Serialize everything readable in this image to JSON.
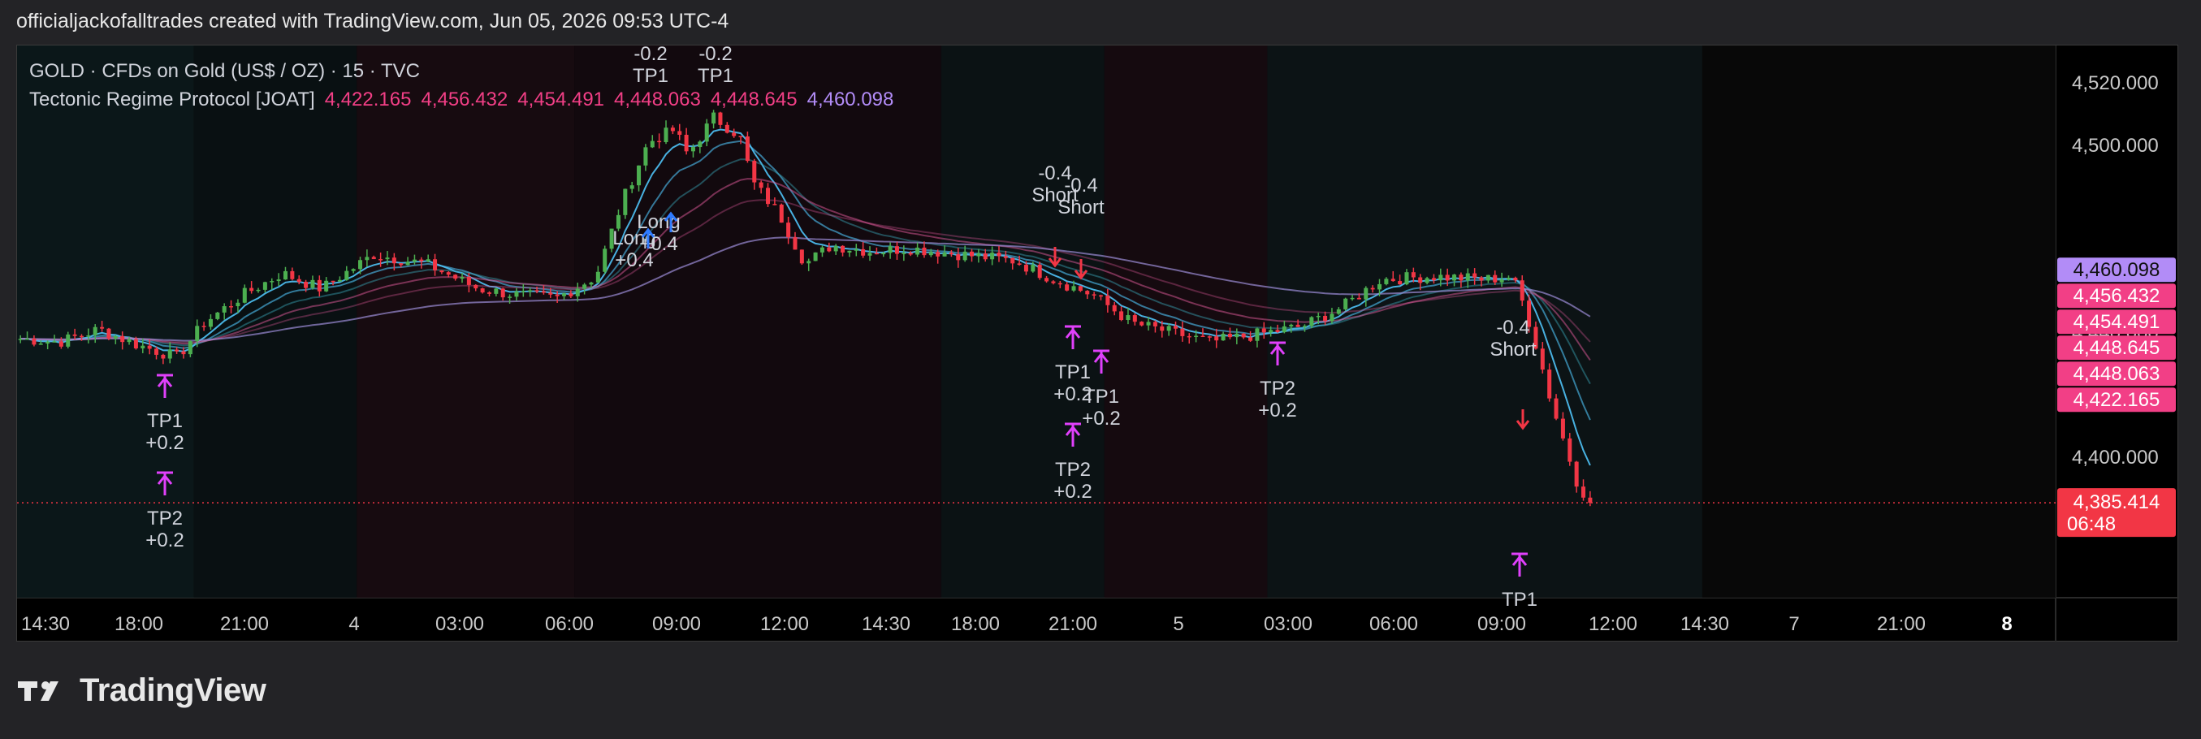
{
  "caption": "officialjackofalltrades created with TradingView.com, Jun 05, 2026 09:53 UTC-4",
  "legend": {
    "symbol_line": "GOLD · CFDs on Gold (US$ / OZ) · 15 · TVC",
    "indicator_name": "Tectonic Regime Protocol [JOAT]",
    "indicator_values": [
      {
        "text": "4,422.165",
        "color": "#f23f86"
      },
      {
        "text": "4,456.432",
        "color": "#f23f86"
      },
      {
        "text": "4,454.491",
        "color": "#f23f86"
      },
      {
        "text": "4,448.063",
        "color": "#f23f86"
      },
      {
        "text": "4,448.645",
        "color": "#f23f86"
      },
      {
        "text": "4,460.098",
        "color": "#b28cf7"
      }
    ]
  },
  "colors": {
    "up": "#4caf50",
    "down": "#f23645",
    "cyan": "#4fc3f7",
    "pink": "#e05a9a",
    "purple": "#9b8cd6",
    "magenta": "#e040fb",
    "blue": "#2f7bff",
    "current_price_line": "#f23645"
  },
  "chart_data": {
    "type": "candlestick",
    "symbol": "GOLD",
    "timeframe": "15",
    "ylim": [
      4355,
      4532
    ],
    "y_ticks": [
      4520,
      4500,
      4440,
      4400
    ],
    "y_tick_labels": [
      "4,520.000",
      "4,500.000",
      "4,440.000",
      "4,400.000"
    ],
    "x_tick_labels": [
      "14:30",
      "18:00",
      "21:00",
      "4",
      "03:00",
      "06:00",
      "09:00",
      "12:00",
      "14:30",
      "18:00",
      "21:00",
      "5",
      "03:00",
      "06:00",
      "09:00",
      "12:00",
      "14:30",
      "7",
      "21:00",
      "8"
    ],
    "bold_x_labels": [
      "8"
    ],
    "price_path": [
      [
        0,
        4438
      ],
      [
        3,
        4437
      ],
      [
        6,
        4441
      ],
      [
        9,
        4436
      ],
      [
        12,
        4432
      ],
      [
        14,
        4443
      ],
      [
        17,
        4452
      ],
      [
        20,
        4459
      ],
      [
        23,
        4454
      ],
      [
        27,
        4465
      ],
      [
        31,
        4462
      ],
      [
        35,
        4454
      ],
      [
        38,
        4452
      ],
      [
        41,
        4451
      ],
      [
        44,
        4458
      ],
      [
        46,
        4482
      ],
      [
        48,
        4501
      ],
      [
        50,
        4505
      ],
      [
        51,
        4497
      ],
      [
        53,
        4509
      ],
      [
        55,
        4503
      ],
      [
        56,
        4488
      ],
      [
        58,
        4478
      ],
      [
        60,
        4462
      ],
      [
        62,
        4468
      ],
      [
        65,
        4466
      ],
      [
        68,
        4467
      ],
      [
        72,
        4465
      ],
      [
        76,
        4463
      ],
      [
        79,
        4457
      ],
      [
        82,
        4452
      ],
      [
        85,
        4443
      ],
      [
        88,
        4440
      ],
      [
        91,
        4437
      ],
      [
        94,
        4439
      ],
      [
        98,
        4442
      ],
      [
        101,
        4448
      ],
      [
        104,
        4457
      ],
      [
        108,
        4458
      ],
      [
        112,
        4457
      ],
      [
        114,
        4458
      ],
      [
        115,
        4448
      ],
      [
        116,
        4434
      ],
      [
        117,
        4418
      ],
      [
        118,
        4405
      ],
      [
        119,
        4392
      ],
      [
        120,
        4385.414
      ]
    ],
    "indicator_lines": [
      {
        "name": "4,422.165",
        "color": "#f23f86",
        "value": 4422.165
      },
      {
        "name": "4,456.432",
        "color": "#f23f86",
        "value": 4456.432
      },
      {
        "name": "4,454.491",
        "color": "#f23f86",
        "value": 4454.491
      },
      {
        "name": "4,448.645",
        "color": "#f23f86",
        "value": 4448.645
      },
      {
        "name": "4,448.063",
        "color": "#f23f86",
        "value": 4448.063
      },
      {
        "name": "4,460.098",
        "color": "#b28cf7",
        "value": 4460.098
      }
    ],
    "price_tags": [
      {
        "label": "4,460.098",
        "value": 4460.098,
        "bg": "#b28cf7",
        "fg": "#101010"
      },
      {
        "label": "4,456.432",
        "value": 4456.432,
        "bg": "#f23f86",
        "fg": "#ffffff"
      },
      {
        "label": "4,454.491",
        "value": 4454.491,
        "bg": "#f23f86",
        "fg": "#ffffff"
      },
      {
        "label": "4,448.645",
        "value": 4448.645,
        "bg": "#f23f86",
        "fg": "#ffffff"
      },
      {
        "label": "4,448.063",
        "value": 4448.063,
        "bg": "#f23f86",
        "fg": "#ffffff"
      },
      {
        "label": "4,422.165",
        "value": 4422.165,
        "bg": "#f23f86",
        "fg": "#ffffff"
      }
    ],
    "current_price": {
      "label": "4,385.414",
      "countdown": "06:48",
      "value": 4385.414
    },
    "annotations": [
      {
        "lines": [
          "TP1",
          "+0.2"
        ],
        "kind": "tp"
      },
      {
        "lines": [
          "TP2",
          "+0.2"
        ],
        "kind": "tp"
      },
      {
        "lines": [
          "-0.2",
          "TP1"
        ],
        "kind": "tp-top"
      },
      {
        "lines": [
          "-0.2",
          "TP1"
        ],
        "kind": "tp-top"
      },
      {
        "lines": [
          "Long",
          "+0.4"
        ],
        "kind": "long"
      },
      {
        "lines": [
          "Long",
          "+0.4"
        ],
        "kind": "long"
      },
      {
        "lines": [
          "-0.4",
          "Short"
        ],
        "kind": "short"
      },
      {
        "lines": [
          "-0.4",
          "Short"
        ],
        "kind": "short"
      },
      {
        "lines": [
          "TP1",
          "+0.2"
        ],
        "kind": "tp"
      },
      {
        "lines": [
          "TP1",
          "+0.2"
        ],
        "kind": "tp"
      },
      {
        "lines": [
          "TP2",
          "+0.2"
        ],
        "kind": "tp"
      },
      {
        "lines": [
          "TP2",
          "+0.2"
        ],
        "kind": "tp"
      },
      {
        "lines": [
          "-0.4",
          "Short"
        ],
        "kind": "short"
      },
      {
        "lines": [
          "TP1"
        ],
        "kind": "tp"
      }
    ]
  },
  "footer": {
    "brand": "TradingView"
  }
}
